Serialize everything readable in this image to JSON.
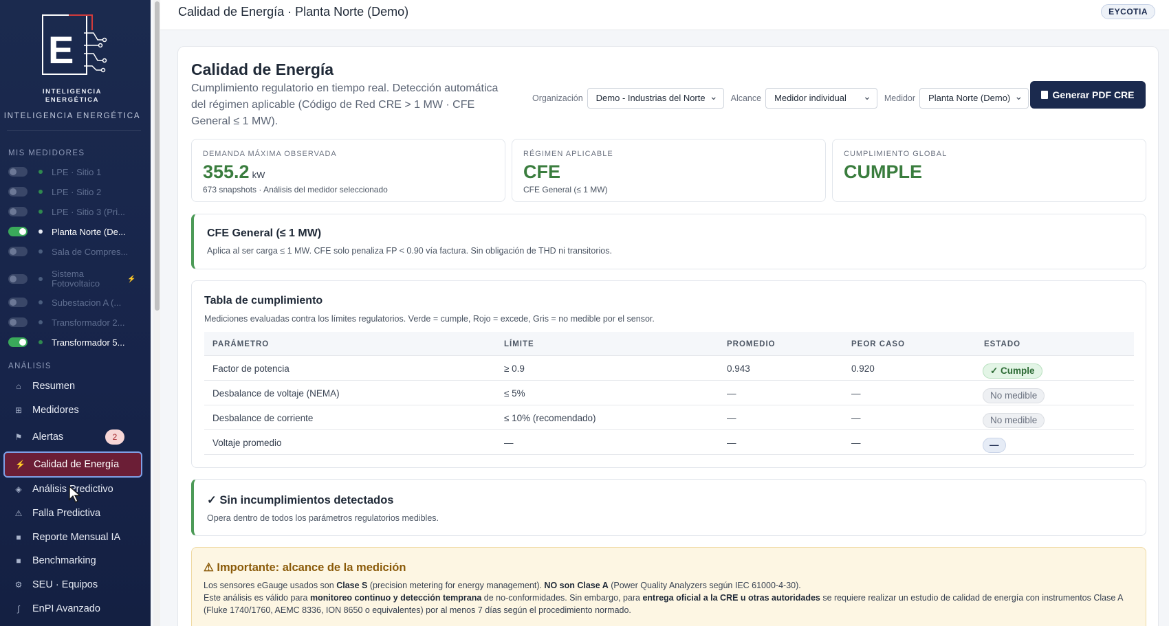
{
  "brand": {
    "line1": "INTELIGENCIA",
    "line2": "ENERGÉTICA",
    "tagline": "INTELIGENCIA ENERGÉTICA",
    "logo_letter": "E"
  },
  "sidebar": {
    "meters_section": "MIS MEDIDORES",
    "meters": [
      {
        "label": "LPE · Sitio 1",
        "on": false,
        "active": false
      },
      {
        "label": "LPE · Sitio 2",
        "on": false,
        "active": false
      },
      {
        "label": "LPE · Sitio 3 (Pri...",
        "on": false,
        "active": false
      },
      {
        "label": "Planta Norte (De...",
        "on": true,
        "active": true
      },
      {
        "label": "Sala de Compres...",
        "on": false,
        "active": false
      },
      {
        "label": "Sistema Fotovoltaico",
        "on": false,
        "active": false
      },
      {
        "label": "Subestacion A (...",
        "on": false,
        "active": false
      },
      {
        "label": "Transformador 2...",
        "on": false,
        "active": false
      },
      {
        "label": "Transformador 5...",
        "on": true,
        "active": true
      }
    ],
    "analysis_section": "ANÁLISIS",
    "nav": [
      {
        "label": "Resumen",
        "icon": "home-icon",
        "glyph": "⌂"
      },
      {
        "label": "Medidores",
        "icon": "grid-icon",
        "glyph": "⊞"
      },
      {
        "label": "Alertas",
        "icon": "flag-icon",
        "glyph": "⚑",
        "badge": "2"
      },
      {
        "label": "Calidad de Energía",
        "icon": "bolt-icon",
        "glyph": "⚡",
        "active": true
      },
      {
        "label": "Análisis Predictivo",
        "icon": "diamond-icon",
        "glyph": "◈"
      },
      {
        "label": "Falla Predictiva",
        "icon": "warning-icon",
        "glyph": "⚠"
      },
      {
        "label": "Reporte Mensual IA",
        "icon": "square-icon",
        "glyph": "■"
      },
      {
        "label": "Benchmarking",
        "icon": "square-icon",
        "glyph": "■"
      },
      {
        "label": "SEU · Equipos",
        "icon": "gear-icon",
        "glyph": "⚙"
      },
      {
        "label": "EnPI Avanzado",
        "icon": "integral-icon",
        "glyph": "∫"
      }
    ]
  },
  "topbar": {
    "title": "Calidad de Energía · Planta Norte (Demo)",
    "badge": "EYCOTIA"
  },
  "main": {
    "title": "Calidad de Energía",
    "description": "Cumplimiento regulatorio en tiempo real. Detección automática del régimen aplicable (Código de Red CRE > 1 MW · CFE General ≤ 1 MW).",
    "filters": {
      "org_label": "Organización",
      "org_value": "Demo - Industrias del Norte",
      "scope_label": "Alcance",
      "scope_value": "Medidor individual",
      "meter_label": "Medidor",
      "meter_value": "Planta Norte (Demo)"
    },
    "pdf_button": "Generar PDF CRE",
    "kpis": [
      {
        "label": "DEMANDA MÁXIMA OBSERVADA",
        "value": "355.2",
        "unit": "kW",
        "sub": "673 snapshots · Análisis del medidor seleccionado"
      },
      {
        "label": "RÉGIMEN APLICABLE",
        "value": "CFE",
        "unit": "",
        "sub": "CFE General (≤ 1 MW)"
      },
      {
        "label": "CUMPLIMIENTO GLOBAL",
        "value": "CUMPLE",
        "unit": "",
        "sub": ""
      }
    ],
    "regime_box": {
      "title": "CFE General (≤ 1 MW)",
      "desc": "Aplica al ser carga ≤ 1 MW. CFE solo penaliza FP < 0.90 vía factura. Sin obligación de THD ni transitorios."
    },
    "table": {
      "title": "Tabla de cumplimiento",
      "desc": "Mediciones evaluadas contra los límites regulatorios. Verde = cumple, Rojo = excede, Gris = no medible por el sensor.",
      "headers": [
        "PARÁMETRO",
        "LÍMITE",
        "PROMEDIO",
        "PEOR CASO",
        "ESTADO"
      ],
      "rows": [
        {
          "param": "Factor de potencia",
          "limit": "≥ 0.9",
          "avg": "0.943",
          "worst": "0.920",
          "status": "✓ Cumple",
          "kind": "ok"
        },
        {
          "param": "Desbalance de voltaje (NEMA)",
          "limit": "≤ 5%",
          "avg": "—",
          "worst": "—",
          "status": "No medible",
          "kind": "nm"
        },
        {
          "param": "Desbalance de corriente",
          "limit": "≤ 10% (recomendado)",
          "avg": "—",
          "worst": "—",
          "status": "No medible",
          "kind": "nm"
        },
        {
          "param": "Voltaje promedio",
          "limit": "—",
          "avg": "—",
          "worst": "—",
          "status": "—",
          "kind": "dash"
        }
      ]
    },
    "ok_box": {
      "title": "✓ Sin incumplimientos detectados",
      "desc": "Opera dentro de todos los parámetros regulatorios medibles."
    },
    "warn_box": {
      "title": "⚠ Importante: alcance de la medición",
      "l1a": "Los sensores eGauge usados son ",
      "l1b": "Clase S",
      "l1c": " (precision metering for energy management). ",
      "l1d": "NO son Clase A",
      "l1e": " (Power Quality Analyzers según IEC 61000-4-30).",
      "l2a": "Este análisis es válido para ",
      "l2b": "monitoreo continuo y detección temprana",
      "l2c": " de no-conformidades. Sin embargo, para ",
      "l2d": "entrega oficial a la CRE u otras autoridades",
      "l2e": " se requiere realizar un estudio de calidad de energía con instrumentos Clase A (Fluke 1740/1760, AEMC 8336, ION 8650 o equivalentes) por al menos 7 días según el procedimiento normado."
    }
  }
}
